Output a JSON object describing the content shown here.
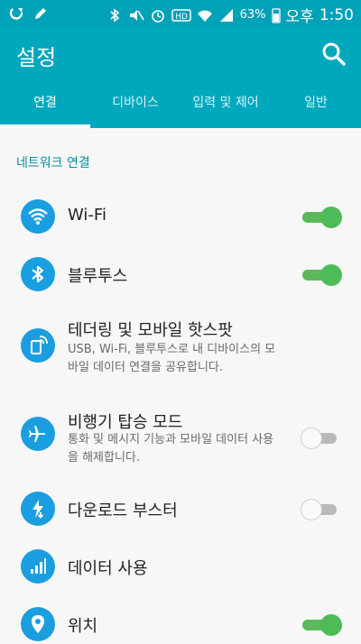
{
  "statusbar": {
    "battery": "63%",
    "ampm": "오후",
    "time": "1:50",
    "icons": [
      "sync-icon",
      "edit-icon",
      "bluetooth-icon",
      "mute-icon",
      "alarm-icon",
      "hd-icon",
      "wifi-icon",
      "signal-icon",
      "battery-icon"
    ]
  },
  "appbar": {
    "title": "설정",
    "search_icon": "search-icon"
  },
  "tabs": [
    {
      "label": "연결",
      "active": true
    },
    {
      "label": "디바이스",
      "active": false
    },
    {
      "label": "입력 및 제어",
      "active": false
    },
    {
      "label": "일반",
      "active": false
    }
  ],
  "section_label": "네트워크 연결",
  "items": [
    {
      "title": "Wi-Fi",
      "icon": "wifi-icon",
      "toggle": "on"
    },
    {
      "title": "블루투스",
      "icon": "bluetooth-icon",
      "toggle": "on"
    },
    {
      "title": "테더링 및 모바일 핫스팟",
      "subtitle": "USB, Wi-Fi, 블루투스로 내 디바이스의 모바일 데이터 연결을 공유합니다.",
      "icon": "hotspot-icon"
    },
    {
      "title": "비행기 탑승 모드",
      "subtitle": "통화 및 메시지 기능과 모바일 데이터 사용을 해제합니다.",
      "icon": "airplane-icon",
      "toggle": "off"
    },
    {
      "title": "다운로드 부스터",
      "icon": "download-booster-icon",
      "toggle": "off"
    },
    {
      "title": "데이터 사용",
      "icon": "data-usage-icon"
    },
    {
      "title": "위치",
      "icon": "location-icon",
      "toggle": "on"
    }
  ],
  "colors": {
    "accent": "#00a8be",
    "icon_bg": "#1a9ee0",
    "toggle_on": "#4dbb57",
    "section": "#0b8ea0"
  }
}
